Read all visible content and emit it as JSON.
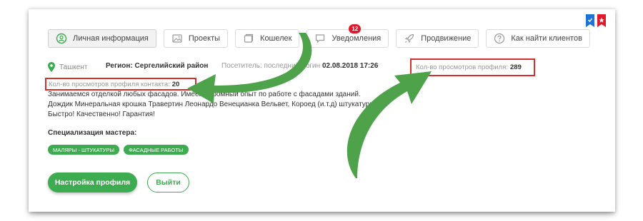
{
  "tabs": [
    {
      "label": "Личная информация",
      "icon": "user-circle-icon",
      "active": true
    },
    {
      "label": "Проекты",
      "icon": "image-icon"
    },
    {
      "label": "Кошелек",
      "icon": "wallet-icon"
    },
    {
      "label": "Уведомления",
      "icon": "chat-bubble-icon",
      "badge": "12"
    },
    {
      "label": "Продвижение",
      "icon": "rocket-icon"
    },
    {
      "label": "Как найти клиентов",
      "icon": "question-circle-icon"
    }
  ],
  "profile": {
    "city": "Ташкент",
    "region": "Регион: Сергелийский район",
    "last_login_label": "Посетитель: последний логин",
    "last_login_value": "02.08.2018 17:26",
    "views_label": "Кол-во просмотров профиля:",
    "views_value": "289",
    "contact_views_label": "Кол-во просмотров профиля контакта:",
    "contact_views_value": "20",
    "description": "Занимаемся отделкой любых фасадов. Имеем огромный опыт по работе с фасадами зданий. Дождик Минеральная крошка Травертин Леонардо Венецианка Вельвет, Короед (и.т.д) штукатурка Быстро! Качественно! Гарантия!",
    "specialization_title": "Специализация мастера:",
    "specializations": [
      "Маляры - штукатуры",
      "Фасадные работы"
    ]
  },
  "actions": {
    "settings_label": "Настройка профиля",
    "logout_label": "Выйти"
  },
  "colors": {
    "accent_green": "#3dab4f",
    "highlight_red": "#d32f2f",
    "badge_red": "#e0192c",
    "bookmark_blue": "#1e73d8",
    "bookmark_red": "#e0192c",
    "arrow_green": "#4ea24a"
  }
}
